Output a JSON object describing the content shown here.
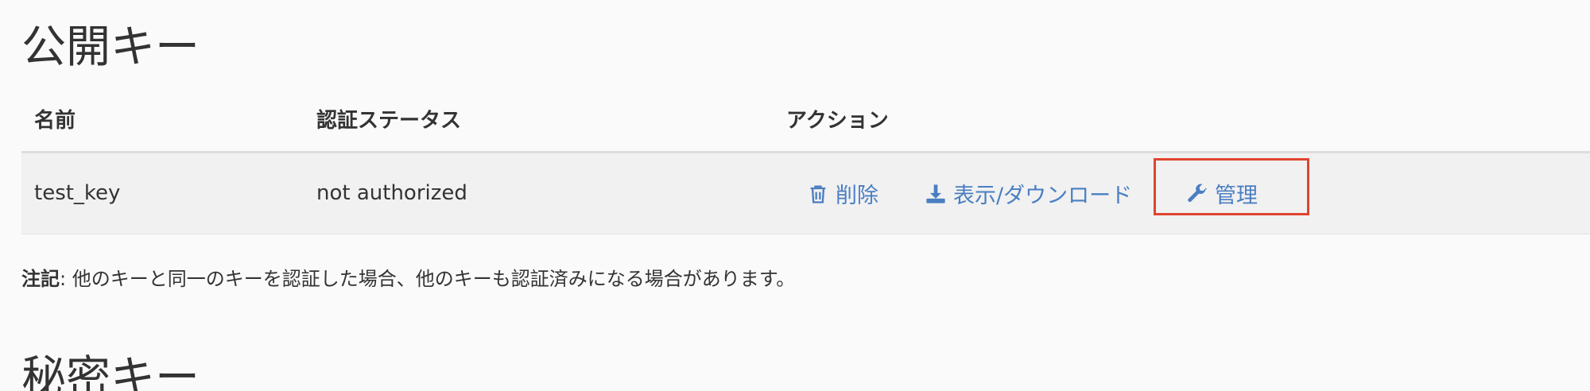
{
  "public_keys": {
    "title": "公開キー",
    "columns": {
      "name": "名前",
      "status": "認証ステータス",
      "actions": "アクション"
    },
    "rows": [
      {
        "name": "test_key",
        "status": "not authorized",
        "actions": {
          "delete": "削除",
          "view_download": "表示/ダウンロード",
          "manage": "管理"
        }
      }
    ],
    "note_label": "注記",
    "note_text": ": 他のキーと同一のキーを認証した場合、他のキーも認証済みになる場合があります。"
  },
  "private_keys": {
    "title": "秘密キー"
  },
  "icons": {
    "delete": "trash-icon",
    "view_download": "download-icon",
    "manage": "wrench-icon"
  },
  "colors": {
    "link": "#4a7ec2",
    "highlight": "#e0442f",
    "row_bg": "#f1f1f1",
    "page_bg": "#fafafa"
  }
}
